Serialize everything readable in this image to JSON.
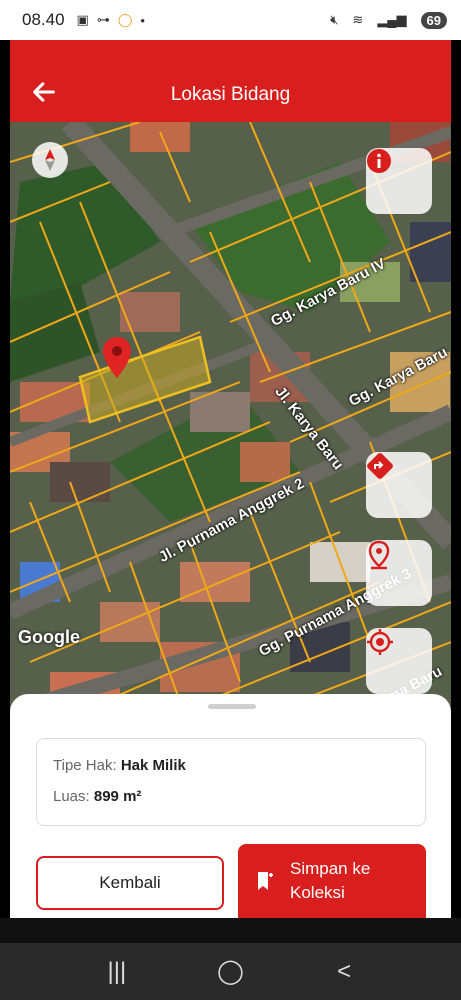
{
  "status": {
    "time": "08.40",
    "battery": "69"
  },
  "appbar": {
    "title": "Lokasi Bidang"
  },
  "map": {
    "streets": [
      "Gg. Karya Baru IV",
      "Gg. Karya Baru",
      "Jl. Karya Baru",
      "Jl. Purnama Anggrek 2",
      "Gg. Purnama Anggrek 3",
      "ma Baru"
    ],
    "attribution": "Google"
  },
  "info": {
    "type_label": "Tipe Hak:",
    "type_value": "Hak Milik",
    "area_label": "Luas:",
    "area_value": "899 m²"
  },
  "buttons": {
    "back": "Kembali",
    "save": "Simpan ke Koleksi"
  },
  "colors": {
    "accent": "#d91e1e"
  }
}
